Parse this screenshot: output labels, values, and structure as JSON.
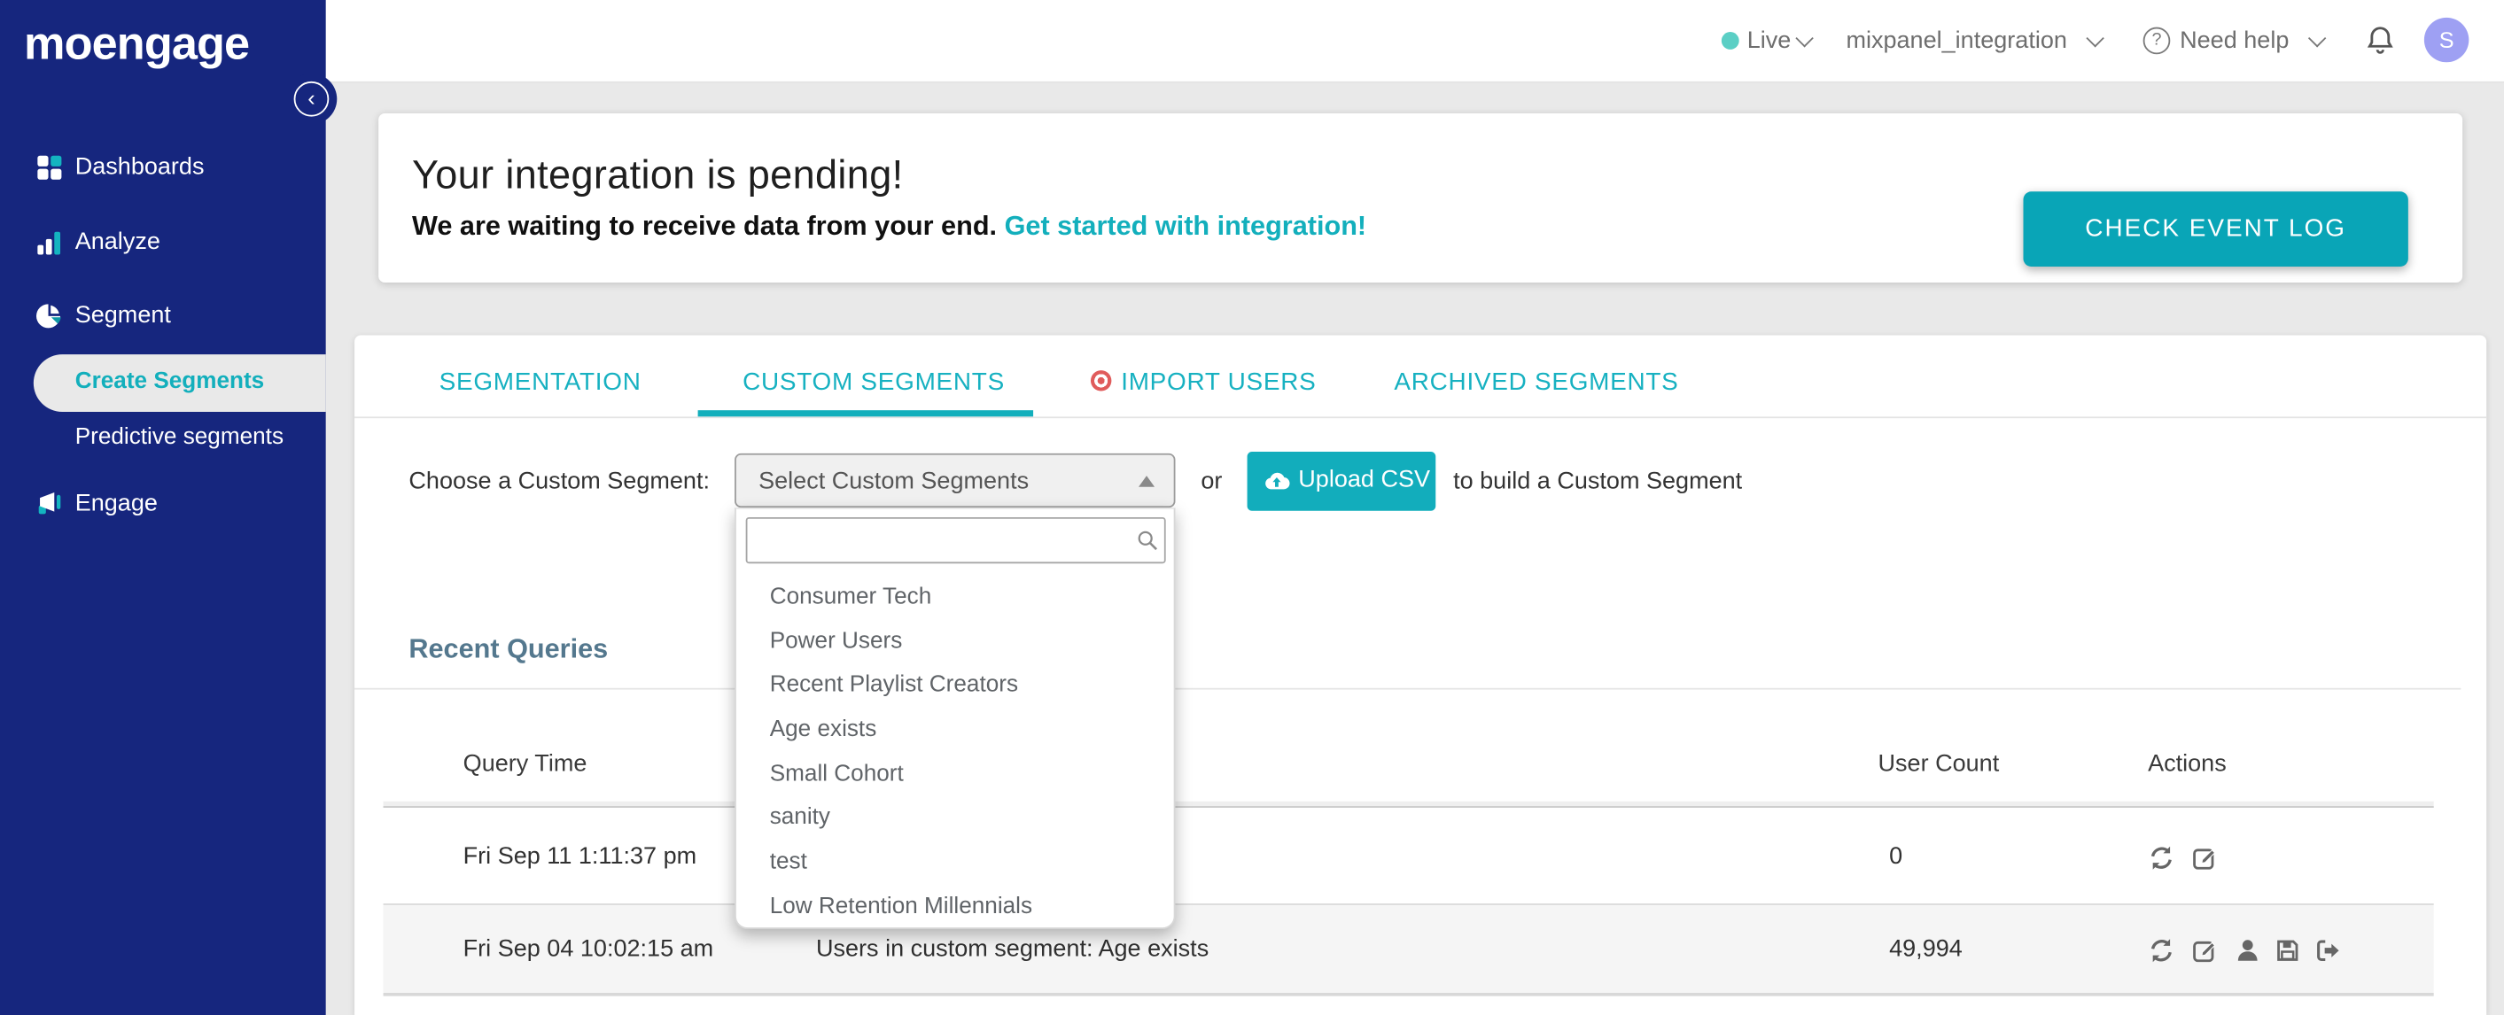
{
  "colors": {
    "sidebar_navy": "#16267E",
    "accent_teal": "#13AFBC",
    "button_teal": "#09A5B7",
    "upload_teal": "#12ADBC",
    "live_dot_teal": "#5BCFC5",
    "avatar_purple": "#9EA0F3",
    "heading_slate": "#54788E",
    "import_badge_red": "#E05C5C",
    "row_alt_gray": "#F5F5F5"
  },
  "sidebar": {
    "logo_text": "moengage",
    "collapse_glyph": "‹",
    "items": [
      {
        "label": "Dashboards",
        "icon": "grid-icon"
      },
      {
        "label": "Analyze",
        "icon": "bar-chart-icon"
      },
      {
        "label": "Segment",
        "icon": "pie-chart-icon"
      },
      {
        "label": "Create Segments",
        "sub": true,
        "active": true
      },
      {
        "label": "Predictive segments",
        "sub": true,
        "active": false
      },
      {
        "label": "Engage",
        "icon": "megaphone-icon"
      }
    ]
  },
  "topbar": {
    "environment": "Live",
    "project": "mixpanel_integration",
    "help": "Need help",
    "help_glyph": "?",
    "avatar_initial": "S"
  },
  "banner": {
    "title": "Your integration is pending!",
    "message": "We are waiting to receive data from your end.",
    "link": "Get started with integration!",
    "button": "CHECK EVENT LOG"
  },
  "tabs": [
    {
      "label": "SEGMENTATION",
      "active": false
    },
    {
      "label": "CUSTOM SEGMENTS",
      "active": true
    },
    {
      "label": "IMPORT USERS",
      "active": false,
      "badge": "red-dot"
    },
    {
      "label": "ARCHIVED SEGMENTS",
      "active": false
    }
  ],
  "picker": {
    "label": "Choose a Custom Segment:",
    "select_value": "Select Custom Segments",
    "conjunction": "or",
    "upload_button": "Upload CSV",
    "suffix": "to build a Custom Segment",
    "search_value": "",
    "options": [
      "Consumer Tech",
      "Power Users",
      "Recent Playlist Creators",
      "Age exists",
      "Small Cohort",
      "sanity",
      "test",
      "Low Retention Millennials"
    ]
  },
  "recent_queries": {
    "heading": "Recent Queries",
    "columns": {
      "time": "Query Time",
      "count": "User Count",
      "actions": "Actions"
    },
    "rows": [
      {
        "time": "Fri Sep 11 1:11:37 pm",
        "query": "",
        "count": "0",
        "actions": [
          "refresh",
          "edit"
        ]
      },
      {
        "time": "Fri Sep 04 10:02:15 am",
        "query": "Users in custom segment: Age exists",
        "count": "49,994",
        "actions": [
          "refresh",
          "edit",
          "user",
          "save",
          "export"
        ]
      }
    ]
  }
}
